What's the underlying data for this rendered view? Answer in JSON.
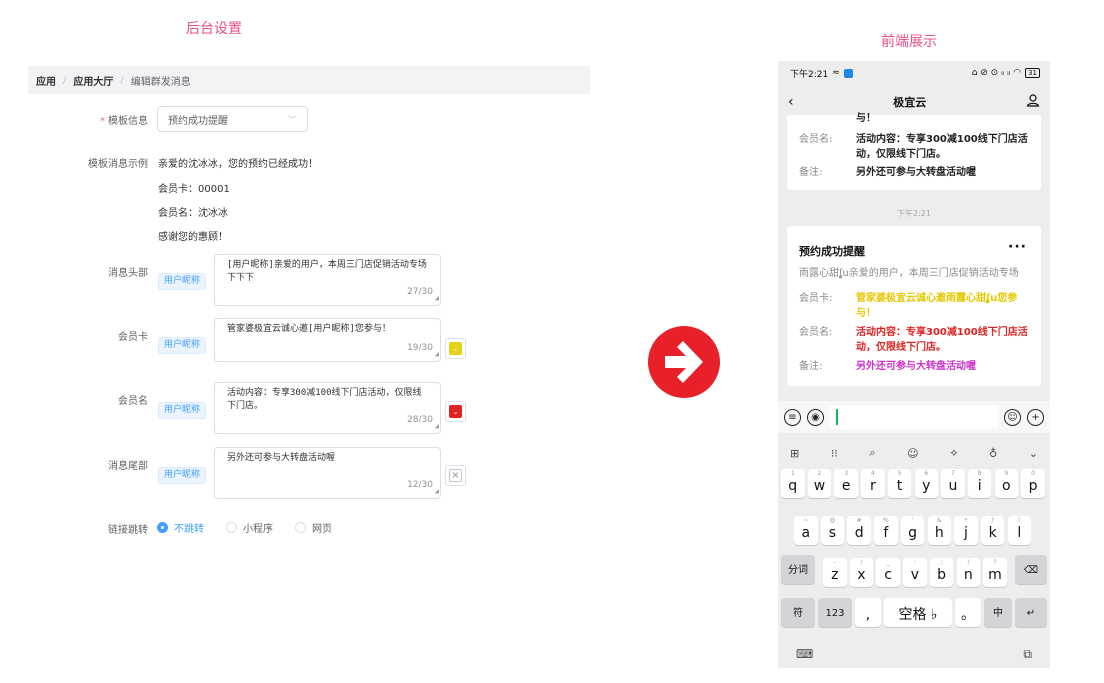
{
  "titles": {
    "backend": "后台设置",
    "frontend": "前端展示"
  },
  "breadcrumb": {
    "items": [
      "应用",
      "应用大厅"
    ],
    "separator": "/",
    "current": "编辑群发消息"
  },
  "form": {
    "template": {
      "label": "模板信息",
      "value": "预约成功提醒"
    },
    "example": {
      "label": "模板消息示例",
      "lines": [
        "亲爱的沈冰冰，您的预约已经成功！",
        "会员卡：00001",
        "会员名：沈冰冰",
        "感谢您的惠顾！"
      ]
    },
    "tag_label": "用户昵称",
    "fields": [
      {
        "label": "消息头部",
        "text": "[用户昵称]亲爱的用户，本周三门店促销活动专场\n下下下",
        "count": "27/30",
        "color": "",
        "color_icon": ""
      },
      {
        "label": "会员卡",
        "text": "管家婆极宜云诚心邀[用户昵称]您参与！",
        "count": "19/30",
        "color": "#e6d21a",
        "color_icon": "chevron-down"
      },
      {
        "label": "会员名",
        "text": "活动内容：专享300减100线下门店活动，仅限线下门店。",
        "count": "28/30",
        "color": "#e02222",
        "color_icon": "chevron-down"
      },
      {
        "label": "消息尾部",
        "text": "另外还可参与大转盘活动喔",
        "count": "12/30",
        "color": "",
        "color_icon": "close"
      }
    ],
    "link": {
      "label": "链接跳转",
      "options": [
        "不跳转",
        "小程序",
        "网页"
      ],
      "selected": "不跳转"
    }
  },
  "phone": {
    "status": {
      "time": "下午2:21",
      "battery": "31",
      "icons": "⌂ ⊘ ⊙ ᵢᵢ ᵢᵢ ◠"
    },
    "nav_title": "极宜云",
    "prev_card": {
      "cut_text": "与！",
      "rows": [
        {
          "key": "会员名:",
          "value": "活动内容：专享300减100线下门店活动，仅限线下门店。"
        },
        {
          "key": "备注:",
          "value": "另外还可参与大转盘活动喔"
        }
      ]
    },
    "timestamp": "下午2:21",
    "card": {
      "title": "预约成功提醒",
      "more": "···",
      "first": "雨露心甜ʃ̡̢u亲爱的用户，本周三门店促销活动专场",
      "rows": [
        {
          "key": "会员卡:",
          "value": "管家婆极宜云诚心邀雨露心甜ʃ̡̢u您参与！",
          "color": "#e6c700"
        },
        {
          "key": "会员名:",
          "value": "活动内容：专享300减100线下门店活动，仅限线下门店。",
          "color": "#e02222"
        },
        {
          "key": "备注:",
          "value": "另外还可参与大转盘活动喔",
          "color": "#cc33cc"
        }
      ]
    },
    "keyboard": {
      "row1": [
        [
          "1",
          "q"
        ],
        [
          "2",
          "w"
        ],
        [
          "3",
          "e"
        ],
        [
          "4",
          "r"
        ],
        [
          "5",
          "t"
        ],
        [
          "6",
          "y"
        ],
        [
          "7",
          "u"
        ],
        [
          "8",
          "i"
        ],
        [
          "9",
          "o"
        ],
        [
          "0",
          "p"
        ]
      ],
      "row2": [
        [
          "~",
          "a"
        ],
        [
          "@",
          "s"
        ],
        [
          "#",
          "d"
        ],
        [
          "%",
          "f"
        ],
        [
          "'",
          "g"
        ],
        [
          "&",
          "h"
        ],
        [
          "*",
          "j"
        ],
        [
          "?",
          "k"
        ],
        [
          "(",
          "l"
        ]
      ],
      "row3": [
        [
          "-",
          "z"
        ],
        [
          "/",
          "x"
        ],
        [
          "_",
          "c"
        ],
        [
          ":",
          "v"
        ],
        [
          ";",
          "b"
        ],
        [
          "!",
          "n"
        ],
        [
          "?",
          "m"
        ]
      ],
      "fn_left": "分词",
      "bottom": {
        "sym": "符",
        "num": "123",
        "comma": ",",
        "space": "空格",
        "period": "。",
        "lang": "中"
      }
    }
  }
}
